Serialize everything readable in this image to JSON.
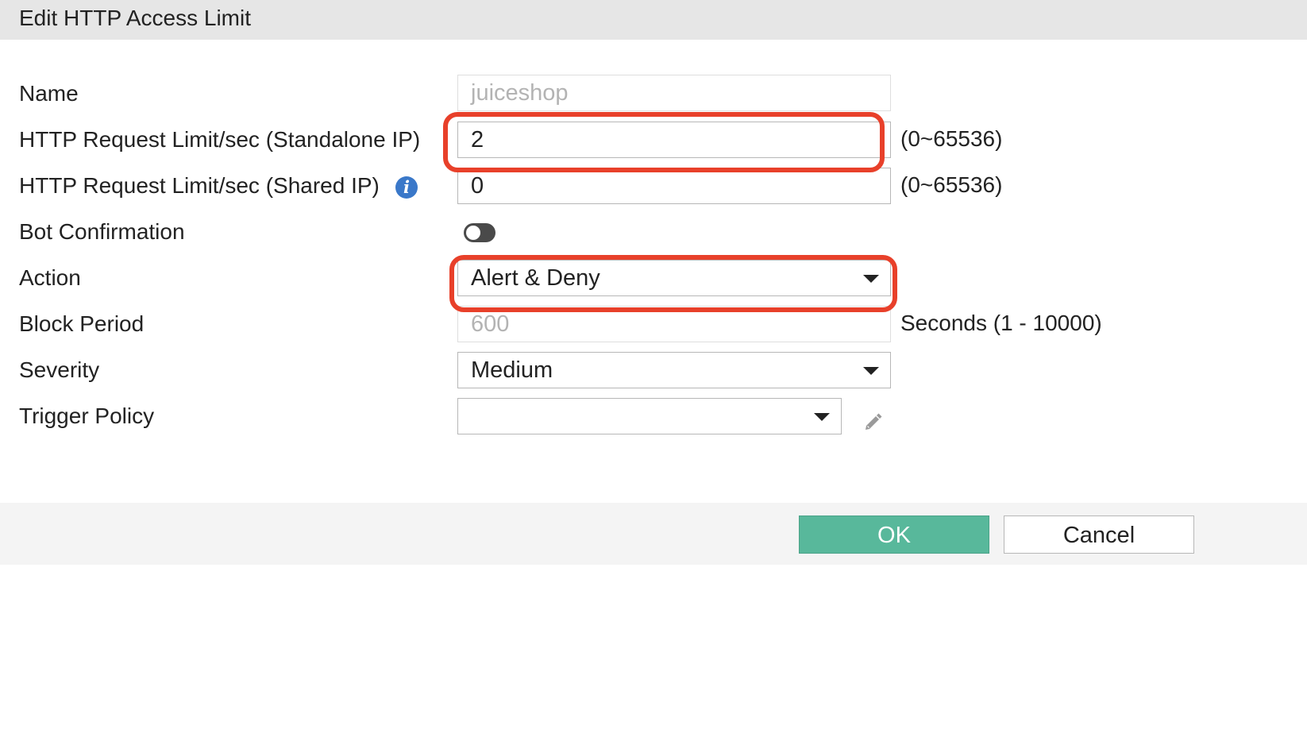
{
  "dialog": {
    "title": "Edit HTTP Access Limit"
  },
  "form": {
    "name": {
      "label": "Name",
      "value": "juiceshop"
    },
    "standalone_limit": {
      "label": "HTTP Request Limit/sec (Standalone IP)",
      "value": "2",
      "range": "(0~65536)"
    },
    "shared_limit": {
      "label": "HTTP Request Limit/sec (Shared IP)",
      "value": "0",
      "range": "(0~65536)",
      "info_icon": "info-icon"
    },
    "bot_confirmation": {
      "label": "Bot Confirmation",
      "enabled": false
    },
    "action": {
      "label": "Action",
      "value": "Alert & Deny"
    },
    "block_period": {
      "label": "Block Period",
      "value": "600",
      "unit": "Seconds (1 - 10000)"
    },
    "severity": {
      "label": "Severity",
      "value": "Medium"
    },
    "trigger_policy": {
      "label": "Trigger Policy",
      "value": "",
      "edit_icon": "pencil-icon"
    }
  },
  "footer": {
    "ok_label": "OK",
    "cancel_label": "Cancel"
  },
  "colors": {
    "highlight": "#e8402a",
    "ok_button": "#58b89b",
    "info_icon": "#3a78c9",
    "header_bg": "#e6e6e6"
  }
}
